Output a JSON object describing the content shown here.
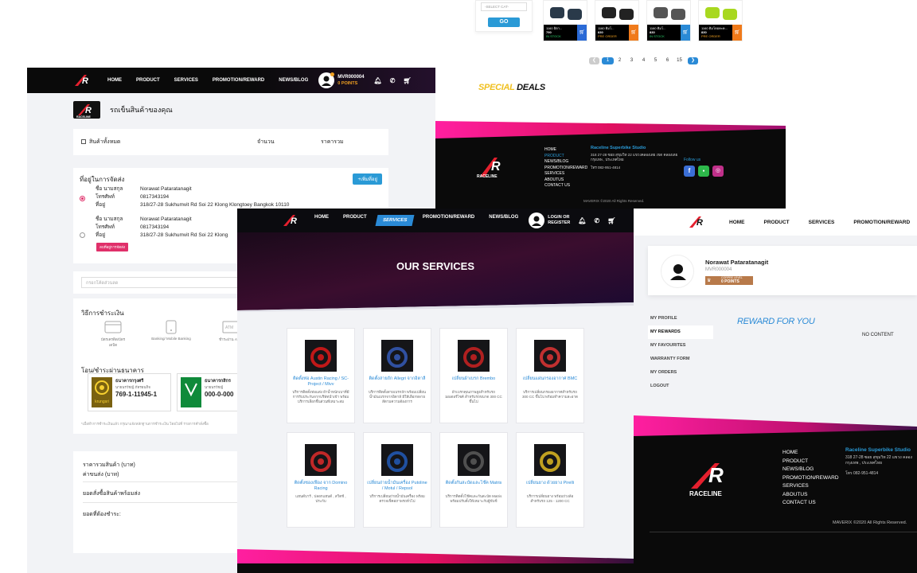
{
  "top_panel": {
    "select_placeholder": "-SELECT CAT-",
    "go_label": "GO",
    "products": [
      {
        "title": "1160 อิตา...",
        "price": "790",
        "stock": "IN STOCK",
        "color": "#2a6ad6"
      },
      {
        "title": "1160 ดิมโ...",
        "price": "830",
        "stock": "PRE ORDER",
        "color": "#f07a1a"
      },
      {
        "title": "1160 ดิมโ...",
        "price": "830",
        "stock": "IN STOCK",
        "color": "#2a8ad6"
      },
      {
        "title": "1160 ดิมโดอคะค...",
        "price": "830",
        "stock": "PRE ORDER",
        "color": "#f07a1a"
      }
    ],
    "pages": [
      "1",
      "2",
      "3",
      "4",
      "5",
      "6",
      "15"
    ],
    "special": "SPECIAL",
    "deals": "DEALS",
    "footer_links": [
      "HOME",
      "PRODUCT",
      "NEWS/BLOG",
      "PROMOTION/REWARD",
      "SERVICES",
      "ABOUTUS",
      "CONTACT US"
    ],
    "footer_active": "PRODUCT",
    "studio": "Raceline Superbike Studio",
    "address": "318 27-28 ซอย สุขุมวิท 22 แขวงคลองเตย เขต คลองเตย กรุงเทพ , ประเทศไทย",
    "phone": "โทร 082-951-4814",
    "follow": "Follow us",
    "copyright": "MAVERIX ©2020 All Rights Reserved."
  },
  "cart_panel": {
    "nav": [
      "HOME",
      "PRODUCT",
      "SERVICES",
      "PROMOTION/REWARD",
      "NEWS/BLOG"
    ],
    "member_id": "MVR000004",
    "points": "0 POINTS",
    "page_title": "รถเข็นสินค้าของคุณ",
    "select_all": "สินค้าทั้งหมด",
    "qty": "จำนวน",
    "total": "ราคารวม",
    "address_title": "ที่อยู่ในการจัดส่ง",
    "add_address": "+เพิ่มที่อยู่",
    "name_label": "ชื่อ นามสกุล",
    "phone_label": "โทรศัพท์",
    "address_label": "ที่อยู่",
    "name": "Norawat Pataratanagit",
    "phone": "0817343194",
    "address": "318/27-28 Sukhumvit Rd Soi 22 Klong Klongtoey Bangkok 10110",
    "address2": "318/27-28 Sukhumvit Rd Soi 22 Klong",
    "delete_label": "ลบที่อยู่การจัดส่ง",
    "coupon_placeholder": "กรอกโค้ดส่วนลด",
    "payment_title": "วิธีการชำระเงิน",
    "methods": [
      "บัตรเครดิต/บัตรเดบิต",
      "Banking/ Mobile Banking",
      "ชำระผ่าน ATM"
    ],
    "bank_title": "โอน/ชำระผ่านธนาคาร",
    "bank1_name": "ธนาคารกรุงศรี",
    "bank1_sub": "นายนรวัชญ์ ภัทรธนกิจ",
    "bank1_acct": "769-1-11945-1",
    "bank1_brand": "krungsri",
    "bank2_name": "ธนาคารกสิกร",
    "bank2_sub": "นายนรวัชญ์",
    "bank2_acct": "000-0-000",
    "note": "*เมื่อทำการชำระเงินแล้ว กรุณาแจ้งหลักฐานการชำระเงิน โดยไปที่ รายการคำสั่งซื้อ",
    "sum_items": "ราคารวมสินค้า (บาท)",
    "shipping": "ค่าขนส่ง (บาท)",
    "grand": "ยอดสั่งซื้อสินค้าพร้อมส่ง",
    "to_pay": "ยอดที่ต้องชำระ:"
  },
  "services_panel": {
    "nav": [
      "HOME",
      "PRODUCT",
      "SERVICES",
      "PROMOTION/REWARD",
      "NEWS/BLOG"
    ],
    "active": "SERVICES",
    "login": "LOGIN OR",
    "register": "REGISTER",
    "hero": "OUR SERVICES",
    "items": [
      {
        "title": "ติดตั้งท่อ Austin Racing / SC-Project / Mivv",
        "desc": "บริการติดตั้งท่อแต่ง ผ้าน้ำหนักเบาที่มีการรับประกันจากบริษัทนำเข้า พร้อมบริการเลือกชิ้นส่วนที่เหมาะสม",
        "color": "#c01818"
      },
      {
        "title": "ติดตั้งสายถัก Allegri จากอิตาลี",
        "desc": "บริการติดตั้งสายเบรกถัก พร้อมเปลี่ยนน้ำมันเบรกจากอิตาลี มีให้เลือกหลายสีตามความต้องการ",
        "color": "#3050a0"
      },
      {
        "title": "เปลี่ยนผ้าเบรก Brembo",
        "desc": "ผ้าเบรกคุณภาพสูงสำหรับรถมอเตอร์ไซค์ สำหรับรถขนาด 300 CC ขึ้นไป",
        "color": "#b02020"
      },
      {
        "title": "เปลี่ยนแผ่นกรองอากาศ BMC",
        "desc": "บริการเปลี่ยนกรองอากาศสำหรับรถ 300 CC ขึ้นไป พร้อมทำความสะอาด",
        "color": "#c03030"
      },
      {
        "title": "ติดตั้งซองเฟือง จาก Domino Racing",
        "desc": "แฮนด์บาร์ , ปลอกแฮนด์ , สวิตช์ , ประกับ",
        "color": "#c02828"
      },
      {
        "title": "เปลี่ยนถ่ายน้ำมันเครื่อง Putoline / Motul / Repsol",
        "desc": "บริการเปลี่ยนถ่ายน้ำมันเครื่อง พร้อมตรวจเช็คสภาพรถทั่วไป",
        "color": "#2050a0"
      },
      {
        "title": "ติดตั้งกันสะบัดและโช๊ค Matris",
        "desc": "บริการติดตั้งโช๊คและกันสะบัด Matris พร้อมปรับตั้งให้เหมาะกับผู้ขับขี่",
        "color": "#505050"
      },
      {
        "title": "เปลี่ยนยาง ด้วยยาง Pirelli",
        "desc": "บริการเปลี่ยนยาง พร้อมถ่วงล้อ สำหรับรถ 125 - 1200 CC",
        "color": "#c0a020"
      }
    ]
  },
  "profile_panel": {
    "nav": [
      "HOME",
      "PRODUCT",
      "SERVICES",
      "PROMOTION/REWARD"
    ],
    "name": "Norawat Pataratanagit",
    "member_id": "MVR000004",
    "level": "CORPRE LEVEL",
    "points": "0 POINTS",
    "menu": [
      "MY PROFILE",
      "MY REWARDS",
      "MY FAVOURITES",
      "WARRANTY FORM",
      "MY ORDERS",
      "LOGOUT"
    ],
    "active": "MY REWARDS",
    "reward_title": "REWARD FOR YOU",
    "no_content": "NO CONTENT",
    "footer_links": [
      "HOME",
      "PRODUCT",
      "NEWS/BLOG",
      "PROMOTION/REWARD",
      "SERVICES",
      "ABOUTUS",
      "CONTACT US"
    ],
    "studio": "Raceline Superbike Studio",
    "address": "318 27-28 ซอย สุขุมวิท 22 แขวง คลอง กรุงเทพ , ประเทศไทย",
    "phone": "โทร 082-951-4814",
    "copyright": "MAVERIX ©2020 All Rights Reserved.",
    "brand": "RACELINE"
  }
}
